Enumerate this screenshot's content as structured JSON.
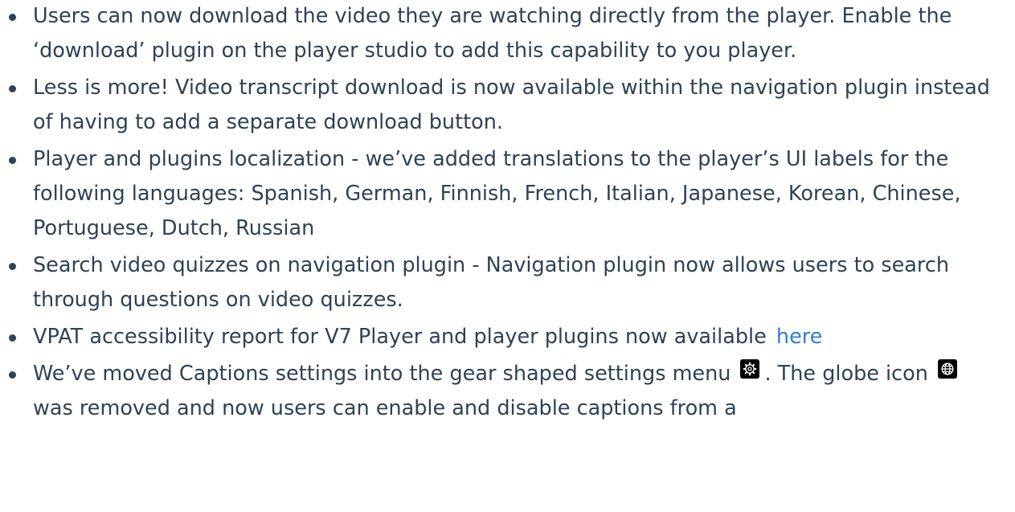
{
  "items": [
    {
      "text": "Users can now download the video they are watching directly from the player. Enable the ‘download’ plugin on the player studio to add this capability to you player."
    },
    {
      "text": "Less is more! Video transcript download is now available within the navigation plugin instead of having to add a separate download button."
    },
    {
      "text": "Player and plugins localization - we’ve added translations to the player’s UI labels for the following languages: Spanish, German, Finnish, French, Italian, Japanese, Korean, Chinese, Portuguese, Dutch, Russian"
    },
    {
      "text": "Search video quizzes on navigation plugin - Navigation plugin now allows users to search through questions on video quizzes."
    },
    {
      "text": "VPAT accessibility report for V7 Player and player plugins now available",
      "link": "here"
    },
    {
      "text_part1": "We’ve moved Captions settings into the gear shaped settings menu",
      "text_part2": ". The globe icon",
      "text_part3": "was removed and now users can enable and disable captions from a",
      "gear_icon": "gear-icon",
      "globe_icon": "globe-icon"
    }
  ],
  "colors": {
    "text": "#2e4256",
    "link": "#2f7fd6",
    "icon_background": "#000000"
  }
}
